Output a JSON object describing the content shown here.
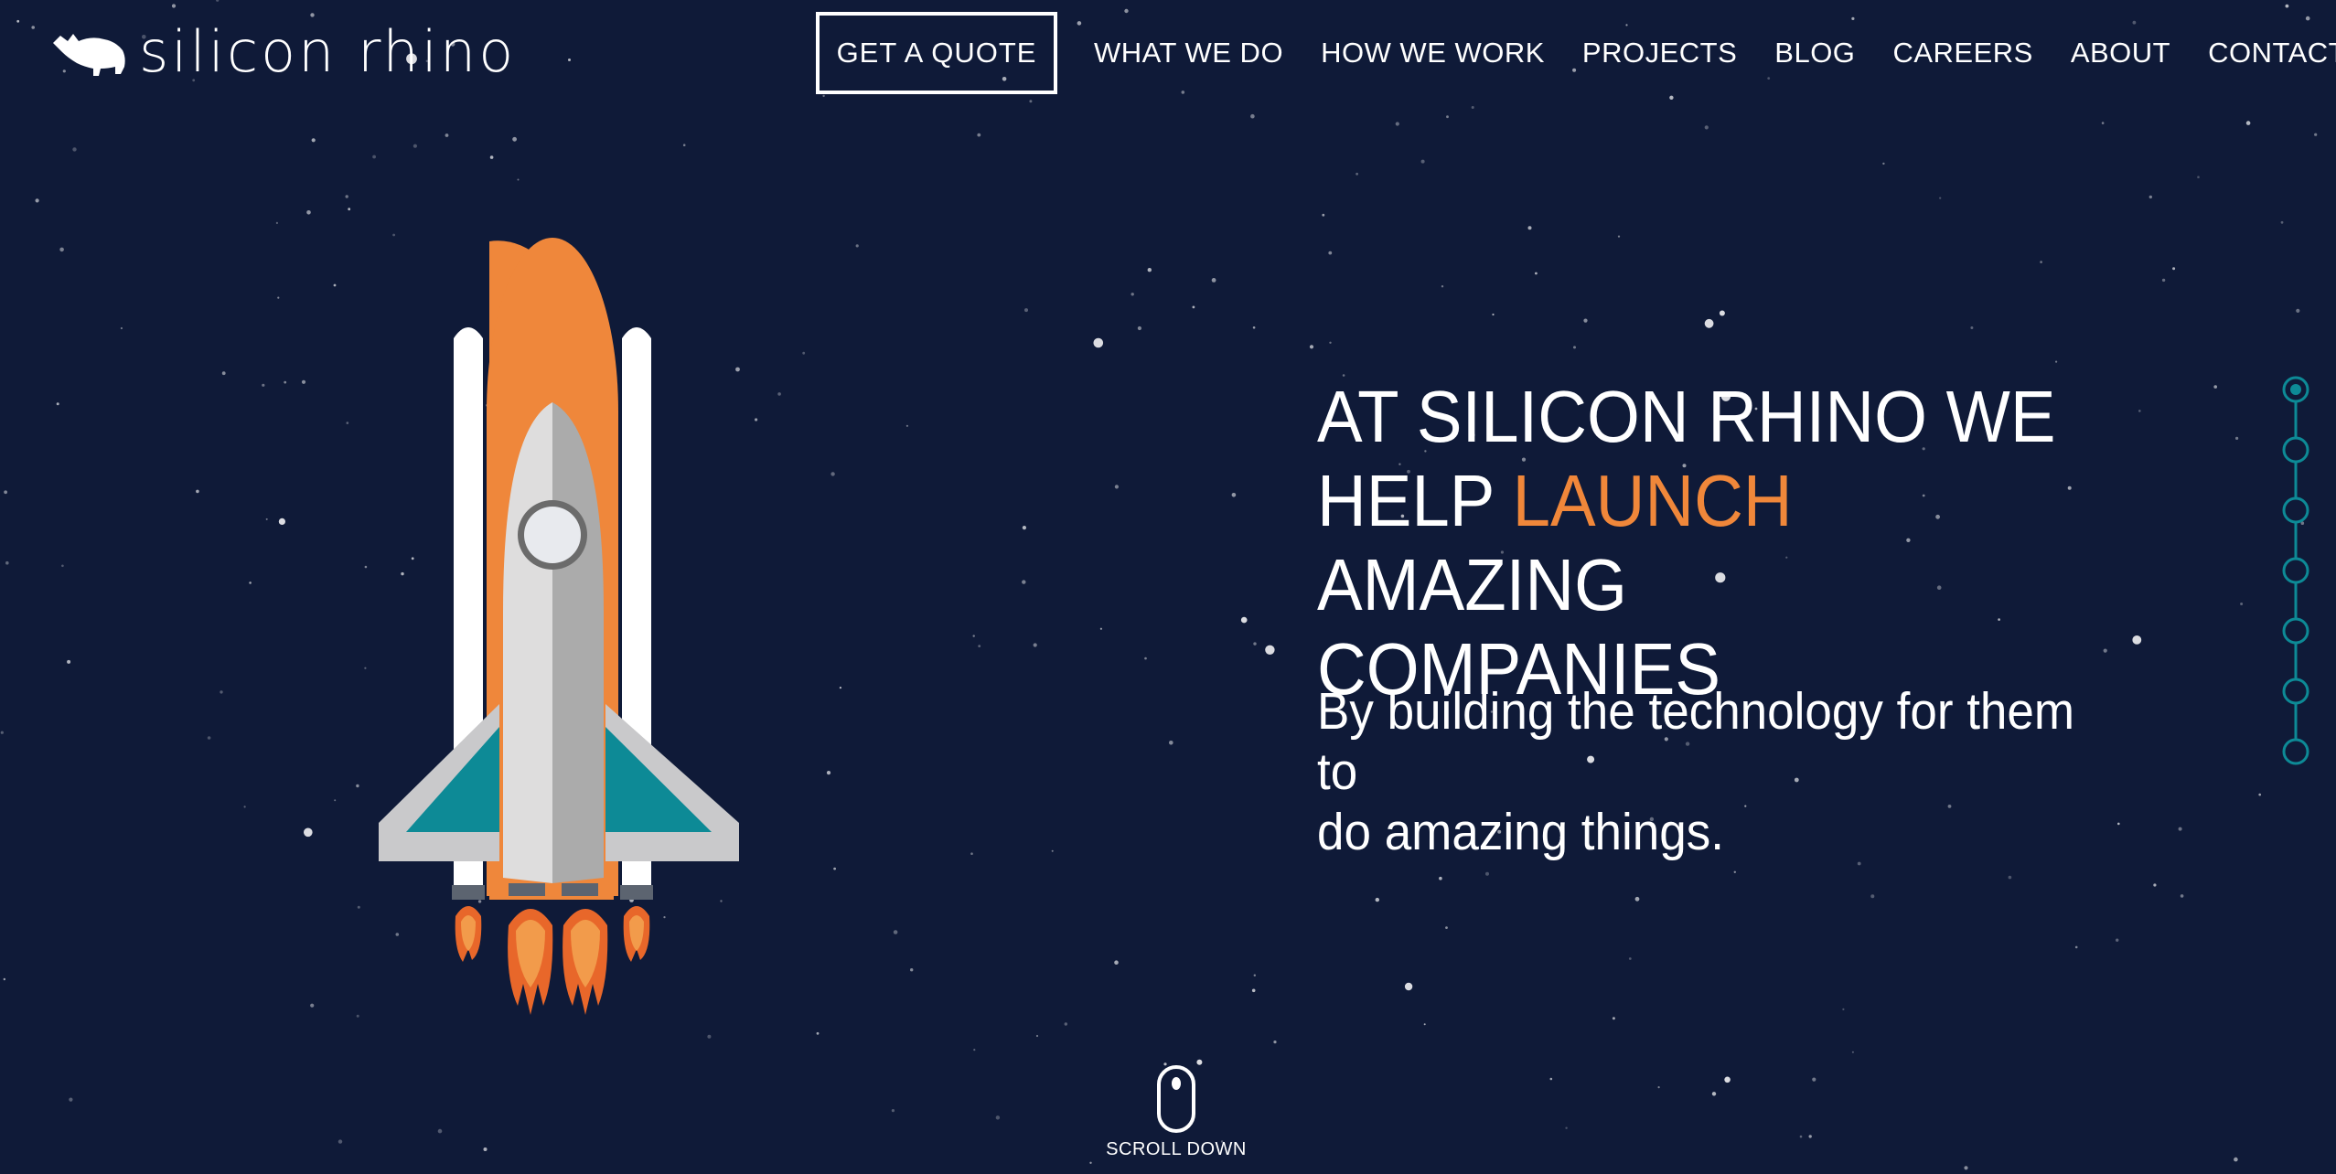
{
  "brand": {
    "name": "silicon rhino",
    "logo_icon": "rhino-icon"
  },
  "header": {
    "quote_button": "GET A QUOTE",
    "nav": [
      {
        "label": "WHAT WE DO"
      },
      {
        "label": "HOW WE WORK"
      },
      {
        "label": "PROJECTS"
      },
      {
        "label": "BLOG"
      },
      {
        "label": "CAREERS"
      },
      {
        "label": "ABOUT"
      },
      {
        "label": "CONTACT"
      }
    ]
  },
  "hero": {
    "headline_line1": "AT SILICON RHINO WE",
    "headline_pre": "HELP ",
    "headline_accent": "LAUNCH",
    "headline_post": " AMAZING",
    "headline_line3": "COMPANIES",
    "subline_line1": "By building the technology for them to",
    "subline_line2": "do amazing things.",
    "illustration_icon": "rocket-icon"
  },
  "side_nav": {
    "count": 7,
    "active_index": 0
  },
  "scroll": {
    "label": "SCROLL DOWN",
    "icon": "mouse-icon"
  },
  "colors": {
    "background": "#0f1a38",
    "accent": "#f0873a",
    "teal": "#0d8a96",
    "text": "#ffffff"
  }
}
